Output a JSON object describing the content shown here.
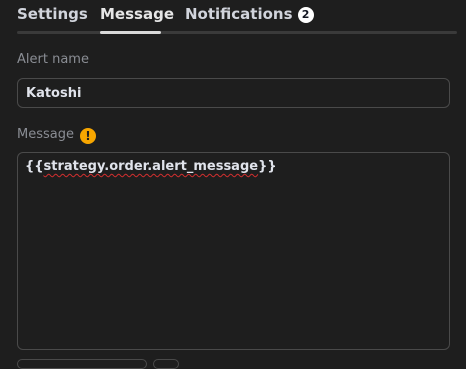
{
  "tabs": {
    "settings": "Settings",
    "message": "Message",
    "notifications": "Notifications",
    "notifications_badge": "2"
  },
  "alert_name": {
    "label": "Alert name",
    "value": "Katoshi"
  },
  "message": {
    "label": "Message",
    "warning_icon": "warning-icon",
    "warning_symbol": "!",
    "value_prefix": "{{",
    "value_body": "strategy.order.alert_message",
    "value_suffix": "}}"
  },
  "colors": {
    "accent_warning": "#f7a600",
    "active_tab_underline": "#d9d9d9",
    "spellcheck_underline": "#d32f2f"
  }
}
